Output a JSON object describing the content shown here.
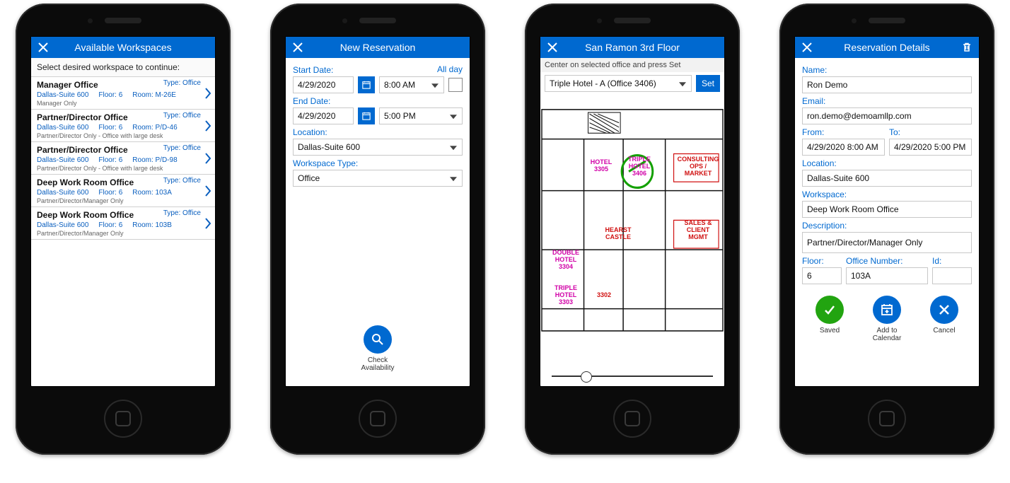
{
  "screens": {
    "s1": {
      "title": "Available Workspaces",
      "subhead": "Select desired workspace to continue:",
      "items": [
        {
          "name": "Manager Office",
          "type": "Type: Office",
          "loc": "Dallas-Suite 600",
          "floor": "Floor: 6",
          "room": "Room: M-26E",
          "desc": "Manager Only"
        },
        {
          "name": "Partner/Director Office",
          "type": "Type: Office",
          "loc": "Dallas-Suite 600",
          "floor": "Floor: 6",
          "room": "Room: P/D-46",
          "desc": "Partner/Director Only - Office with large desk"
        },
        {
          "name": "Partner/Director Office",
          "type": "Type: Office",
          "loc": "Dallas-Suite 600",
          "floor": "Floor: 6",
          "room": "Room: P/D-98",
          "desc": "Partner/Director Only - Office with large desk"
        },
        {
          "name": "Deep Work Room Office",
          "type": "Type: Office",
          "loc": "Dallas-Suite 600",
          "floor": "Floor: 6",
          "room": "Room: 103A",
          "desc": "Partner/Director/Manager Only"
        },
        {
          "name": "Deep Work Room Office",
          "type": "Type: Office",
          "loc": "Dallas-Suite 600",
          "floor": "Floor: 6",
          "room": "Room: 103B",
          "desc": "Partner/Director/Manager Only"
        }
      ]
    },
    "s2": {
      "title": "New Reservation",
      "startLabel": "Start Date:",
      "endLabel": "End Date:",
      "allDay": "All day",
      "startDate": "4/29/2020",
      "startTime": "8:00 AM",
      "endDate": "4/29/2020",
      "endTime": "5:00 PM",
      "locationLabel": "Location:",
      "location": "Dallas-Suite 600",
      "wsTypeLabel": "Workspace Type:",
      "wsType": "Office",
      "check": "Check Availability"
    },
    "s3": {
      "title": "San Ramon 3rd Floor",
      "hint": "Center on selected office and press Set",
      "selected": "Triple Hotel - A (Office 3406)",
      "set": "Set",
      "rooms": {
        "hotel": "HOTEL 3305",
        "triple": "TRIPLE HOTEL 3406",
        "consult": "CONSULTING OPS / MARKET",
        "hearst": "HEARST CASTLE",
        "sales": "SALES & CLIENT MGMT",
        "double": "DOUBLE HOTEL 3304",
        "triple2": "TRIPLE HOTEL 3303",
        "n3302": "3302"
      }
    },
    "s4": {
      "title": "Reservation Details",
      "labels": {
        "name": "Name:",
        "email": "Email:",
        "from": "From:",
        "to": "To:",
        "location": "Location:",
        "workspace": "Workspace:",
        "description": "Description:",
        "floor": "Floor:",
        "off": "Office Number:",
        "id": "Id:"
      },
      "v": {
        "name": "Ron Demo",
        "email": "ron.demo@demoamllp.com",
        "from": "4/29/2020 8:00 AM",
        "to": "4/29/2020 5:00 PM",
        "location": "Dallas-Suite 600",
        "workspace": "Deep Work Room Office",
        "description": "Partner/Director/Manager Only",
        "floor": "6",
        "off": "103A",
        "id": ""
      },
      "actions": {
        "saved": "Saved",
        "cal": "Add to Calendar",
        "cancel": "Cancel"
      }
    }
  }
}
